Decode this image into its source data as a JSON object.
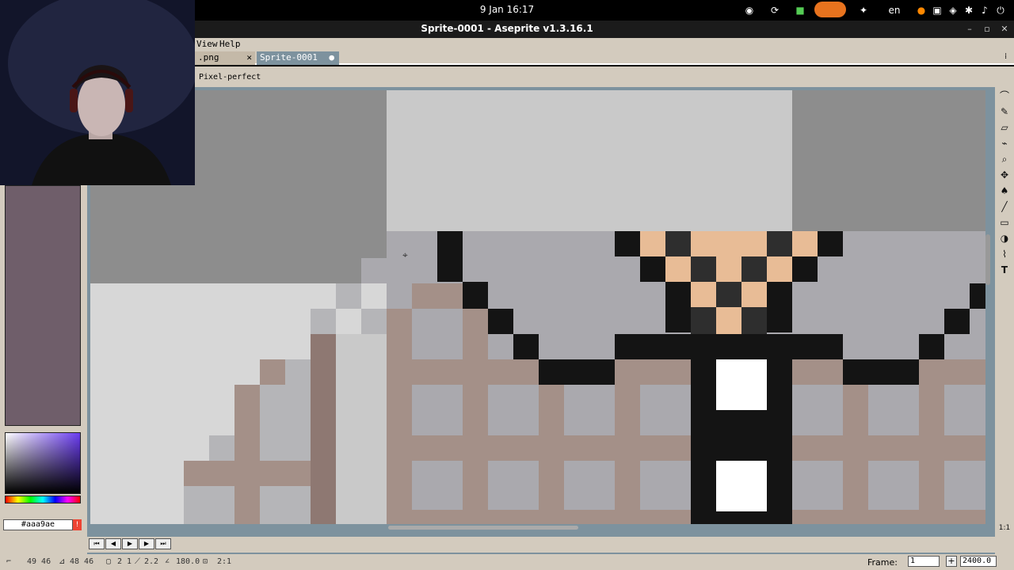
{
  "system_bar": {
    "clock": "9 Jan  16:17",
    "language": "en",
    "icons": [
      "screen-share-icon",
      "steam-icon",
      "lock-icon",
      "recording-icon",
      "accessibility-icon",
      "microphone-icon",
      "network-icon",
      "wifi-icon",
      "volume-icon",
      "power-icon"
    ]
  },
  "window": {
    "title": "Sprite-0001 - Aseprite v1.3.16.1"
  },
  "menu": {
    "view": "View",
    "help": "Help"
  },
  "tabs": [
    {
      "label": ".png",
      "closable": true
    },
    {
      "label": "Sprite-0001",
      "modified": true
    }
  ],
  "context_bar": {
    "pixel_perfect": "Pixel-perfect"
  },
  "colors": {
    "foreground_hex": "#aaa9ae",
    "background_hex": "#cccccd",
    "swatch": "#6f5e6a",
    "accent_red": "#e80000"
  },
  "status": {
    "coords": "49 46",
    "size": "48 46",
    "selection": "2 1",
    "ratio": "2.2",
    "angle": "180.0",
    "scale": "2:1",
    "frame_label": "Frame:",
    "frame_value": "1",
    "zoom_value": "2400.0"
  },
  "right_tools": [
    "lasso-icon",
    "pencil-icon",
    "eraser-icon",
    "eyedropper-icon",
    "zoom-icon",
    "move-icon",
    "fill-icon",
    "line-icon",
    "rectangle-icon",
    "contour-icon",
    "blur-icon",
    "text-icon"
  ]
}
